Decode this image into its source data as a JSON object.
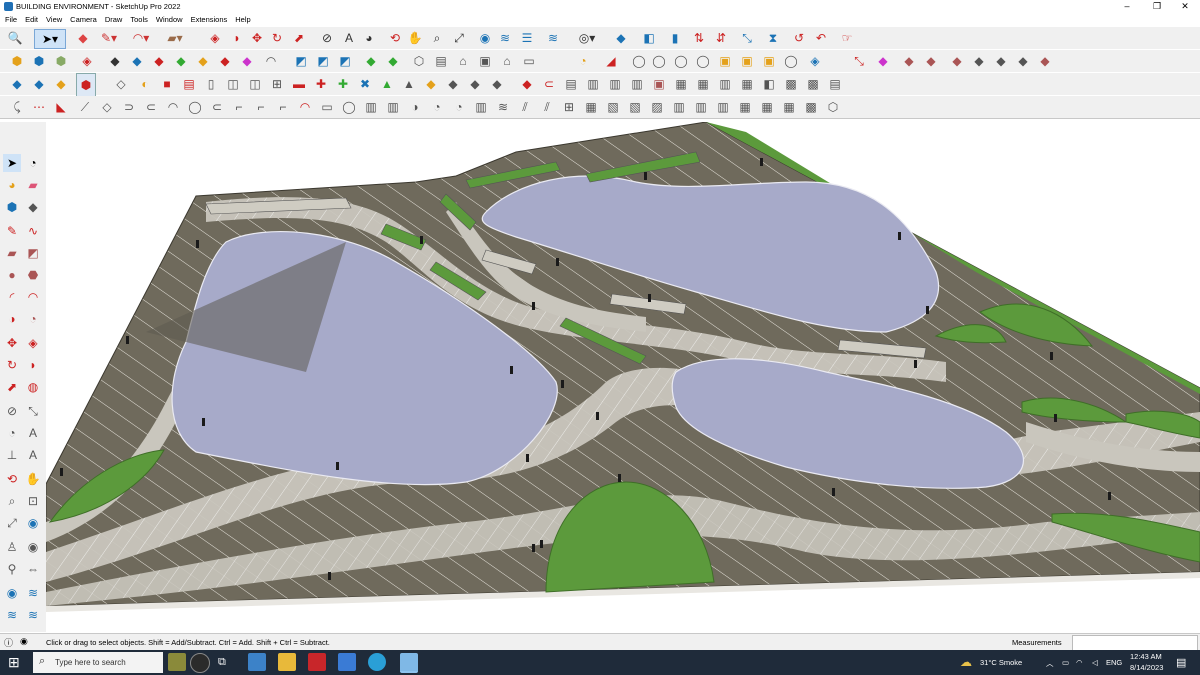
{
  "window": {
    "title": "BUILDING ENVIRONMENT - SketchUp Pro 2022",
    "controls": {
      "minimize": "–",
      "maximize": "❐",
      "close": "✕"
    }
  },
  "menu": [
    "File",
    "Edit",
    "View",
    "Camera",
    "Draw",
    "Tools",
    "Window",
    "Extensions",
    "Help"
  ],
  "status": {
    "message": "Click or drag to select objects. Shift = Add/Subtract. Ctrl = Add. Shift + Ctrl = Subtract.",
    "measurements_label": "Measurements"
  },
  "taskbar": {
    "search_placeholder": "Type here to search",
    "weather": "31°C  Smoke",
    "language": "ENG",
    "time": "12:43 AM",
    "date": "8/14/2023"
  },
  "colors": {
    "ground": "#6f6a5c",
    "paving": "#c9c6bd",
    "water": "#a7aac9",
    "lawn": "#5c9a3c",
    "toolbar_bg": "#f0f0f0",
    "taskbar_bg": "#1f2b3a"
  }
}
